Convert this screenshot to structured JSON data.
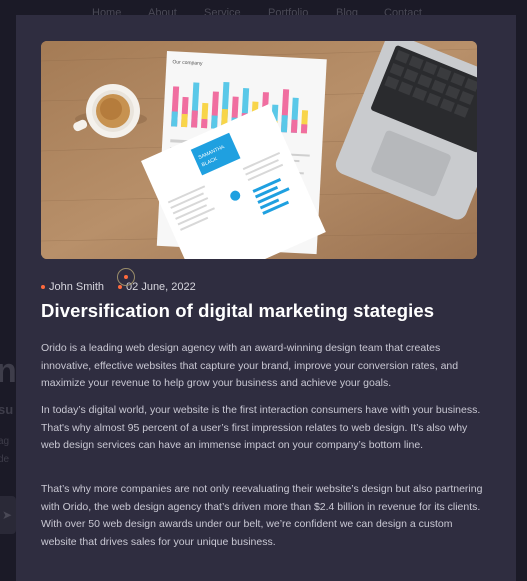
{
  "background": {
    "nav": [
      "Home",
      "About",
      "Service",
      "Portfolio",
      "Blog",
      "Contact"
    ]
  },
  "post": {
    "author": "John Smith",
    "date": "02 June, 2022",
    "title": "Diversification of digital marketing stategies",
    "paragraphs": [
      "Orido is a leading web design agency with an award-winning design team that creates innovative, effective websites that capture your brand, improve your conversion rates, and maximize your revenue to help grow your business and achieve your goals.",
      "In today’s digital world, your website is the first interaction consumers have with your business. That's why almost 95 percent of a user’s first impression relates to web design. It’s also why web design services can have an immense impact on your company’s bottom line.",
      "That’s why more companies are not only reevaluating their website’s design but also partnering with Orido, the web design agency that’s driven more than $2.4 billion in revenue for its clients. With over 50 web design awards under our belt, we’re confident we can design a custom website that drives sales for your unique business."
    ]
  },
  "colors": {
    "modal_bg": "#2f2d40",
    "accent": "#ff6a3d",
    "page_bg": "#1b1a27"
  }
}
